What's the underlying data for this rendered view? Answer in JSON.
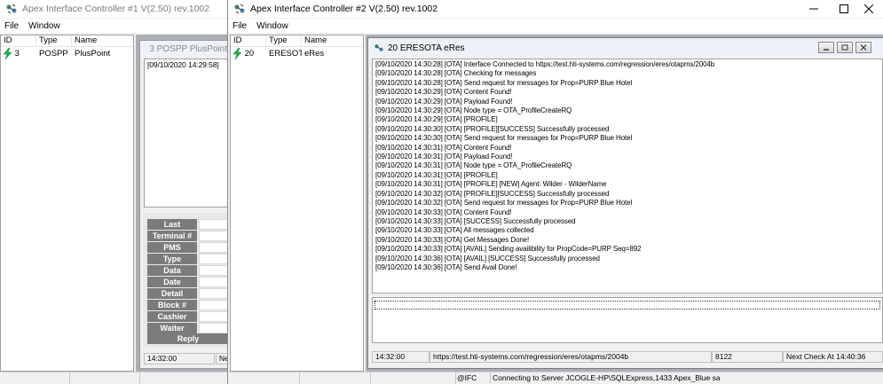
{
  "window1": {
    "title": "Apex Interface Controller #1 V(2.50) rev.1002",
    "menu": [
      "File",
      "Window"
    ],
    "list_headers": [
      "ID",
      "Type",
      "Name"
    ],
    "list_row": {
      "id": "3",
      "type": "POSPP",
      "name": "PlusPoint"
    },
    "child_title": "3 POSPP PlusPoint",
    "child_log_first": "[09/10/2020 14:29:58]",
    "grid_labels": [
      "Last",
      "Terminal #",
      "PMS",
      "Type",
      "Data",
      "Date",
      "Detail",
      "Block #",
      "Cashier",
      "Waiter"
    ],
    "reply_label": "Reply",
    "status_time": "14:32:00",
    "status_next": "Ne"
  },
  "window2": {
    "title": "Apex Interface Controller #2 V(2.50) rev.1002",
    "menu": [
      "File",
      "Window"
    ],
    "list_headers": [
      "ID",
      "Type",
      "Name"
    ],
    "list_row": {
      "id": "20",
      "type": "ERESOTA",
      "name": "eRes"
    },
    "child_title": "20 ERESOTA eRes",
    "log_lines": [
      "[09/10/2020 14:30:28]  [OTA] Interface Connected to https://test.hti-systems.com/regression/eres/otapms/2004b",
      "[09/10/2020 14:30:28]  [OTA] Checking for messages",
      "[09/10/2020 14:30:28]  [OTA] Send request for messages for Prop=PURP Blue Hotel",
      "[09/10/2020 14:30:29]  [OTA] Content Found!",
      "[09/10/2020 14:30:29]  [OTA] Payload Found!",
      "[09/10/2020 14:30:29]  [OTA] Node type = OTA_ProfileCreateRQ",
      "[09/10/2020 14:30:29]  [OTA] [PROFILE]",
      "[09/10/2020 14:30:30]  [OTA] [PROFILE][SUCCESS] Successfully processed",
      "[09/10/2020 14:30:30]  [OTA] Send request for messages for Prop=PURP Blue Hotel",
      "[09/10/2020 14:30:31]  [OTA] Content Found!",
      "[09/10/2020 14:30:31]  [OTA] Payload Found!",
      "[09/10/2020 14:30:31]  [OTA] Node type = OTA_ProfileCreateRQ",
      "[09/10/2020 14:30:31]  [OTA] [PROFILE]",
      "[09/10/2020 14:30:31]  [OTA] [PROFILE] [NEW] Agent: Wilder - WilderName",
      "[09/10/2020 14:30:32]  [OTA] [PROFILE][SUCCESS] Successfully processed",
      "[09/10/2020 14:30:32]  [OTA] Send request for messages for Prop=PURP Blue Hotel",
      "[09/10/2020 14:30:33]  [OTA] Content Found!",
      "[09/10/2020 14:30:33]  [OTA] [SUCCESS] Successfully processed",
      "[09/10/2020 14:30:33]  [OTA] All messages collected",
      "[09/10/2020 14:30:33]  [OTA] Get Messages Done!",
      "[09/10/2020 14:30:33]  [OTA] [AVAIL] Sending availibility for PropCode=PURP Seq=892",
      "[09/10/2020 14:30:36]  [OTA] [AVAIL] [SUCCESS] Successfully processed",
      "[09/10/2020 14:30:36]  [OTA] Send Avail Done!"
    ],
    "status_time": "14:32:00",
    "status_url": "https://test.hti-systems.com/regression/eres/otapms/2004b",
    "status_port": "8122",
    "status_next": "Next Check At 14:40:36",
    "footer_ifc": "@IFC",
    "footer_conn": "Connecting to Server JCOGLE-HP\\SQLExpress,1433 Apex_Blue sa"
  },
  "icons": {
    "app": "app-connector-icon",
    "status": "lightning-bolt-icon"
  },
  "colors": {
    "bolt": "#22b14c",
    "grid_label": "#7b7b7b",
    "mdi_title": "#eef2f8"
  }
}
